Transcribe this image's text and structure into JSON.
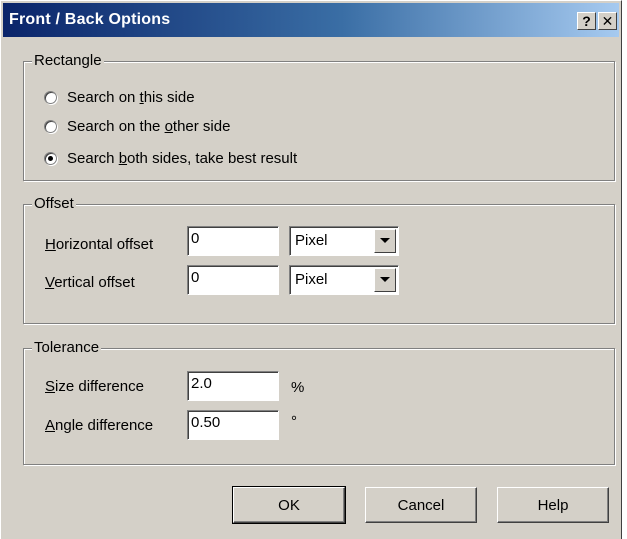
{
  "window": {
    "title": "Front / Back Options",
    "help_button": "?",
    "close_button": "✕"
  },
  "rectangle": {
    "legend": "Rectangle",
    "options": [
      {
        "pre": "Search on ",
        "mn": "t",
        "post": "his side",
        "checked": false
      },
      {
        "pre": "Search on the ",
        "mn": "o",
        "post": "ther side",
        "checked": false
      },
      {
        "pre": "Search ",
        "mn": "b",
        "post": "oth sides, take best result",
        "checked": true
      }
    ]
  },
  "offset": {
    "legend": "Offset",
    "horizontal": {
      "pre": "",
      "mn": "H",
      "post": "orizontal offset",
      "value": "0",
      "unit": "Pixel"
    },
    "vertical": {
      "pre": "",
      "mn": "V",
      "post": "ertical offset",
      "value": "0",
      "unit": "Pixel"
    }
  },
  "tolerance": {
    "legend": "Tolerance",
    "size": {
      "pre": "",
      "mn": "S",
      "post": "ize difference",
      "value": "2.0",
      "unit": "%"
    },
    "angle": {
      "pre": "",
      "mn": "A",
      "post": "ngle difference",
      "value": "0.50",
      "unit": "°"
    }
  },
  "buttons": {
    "ok": "OK",
    "cancel": "Cancel",
    "help": "Help"
  }
}
